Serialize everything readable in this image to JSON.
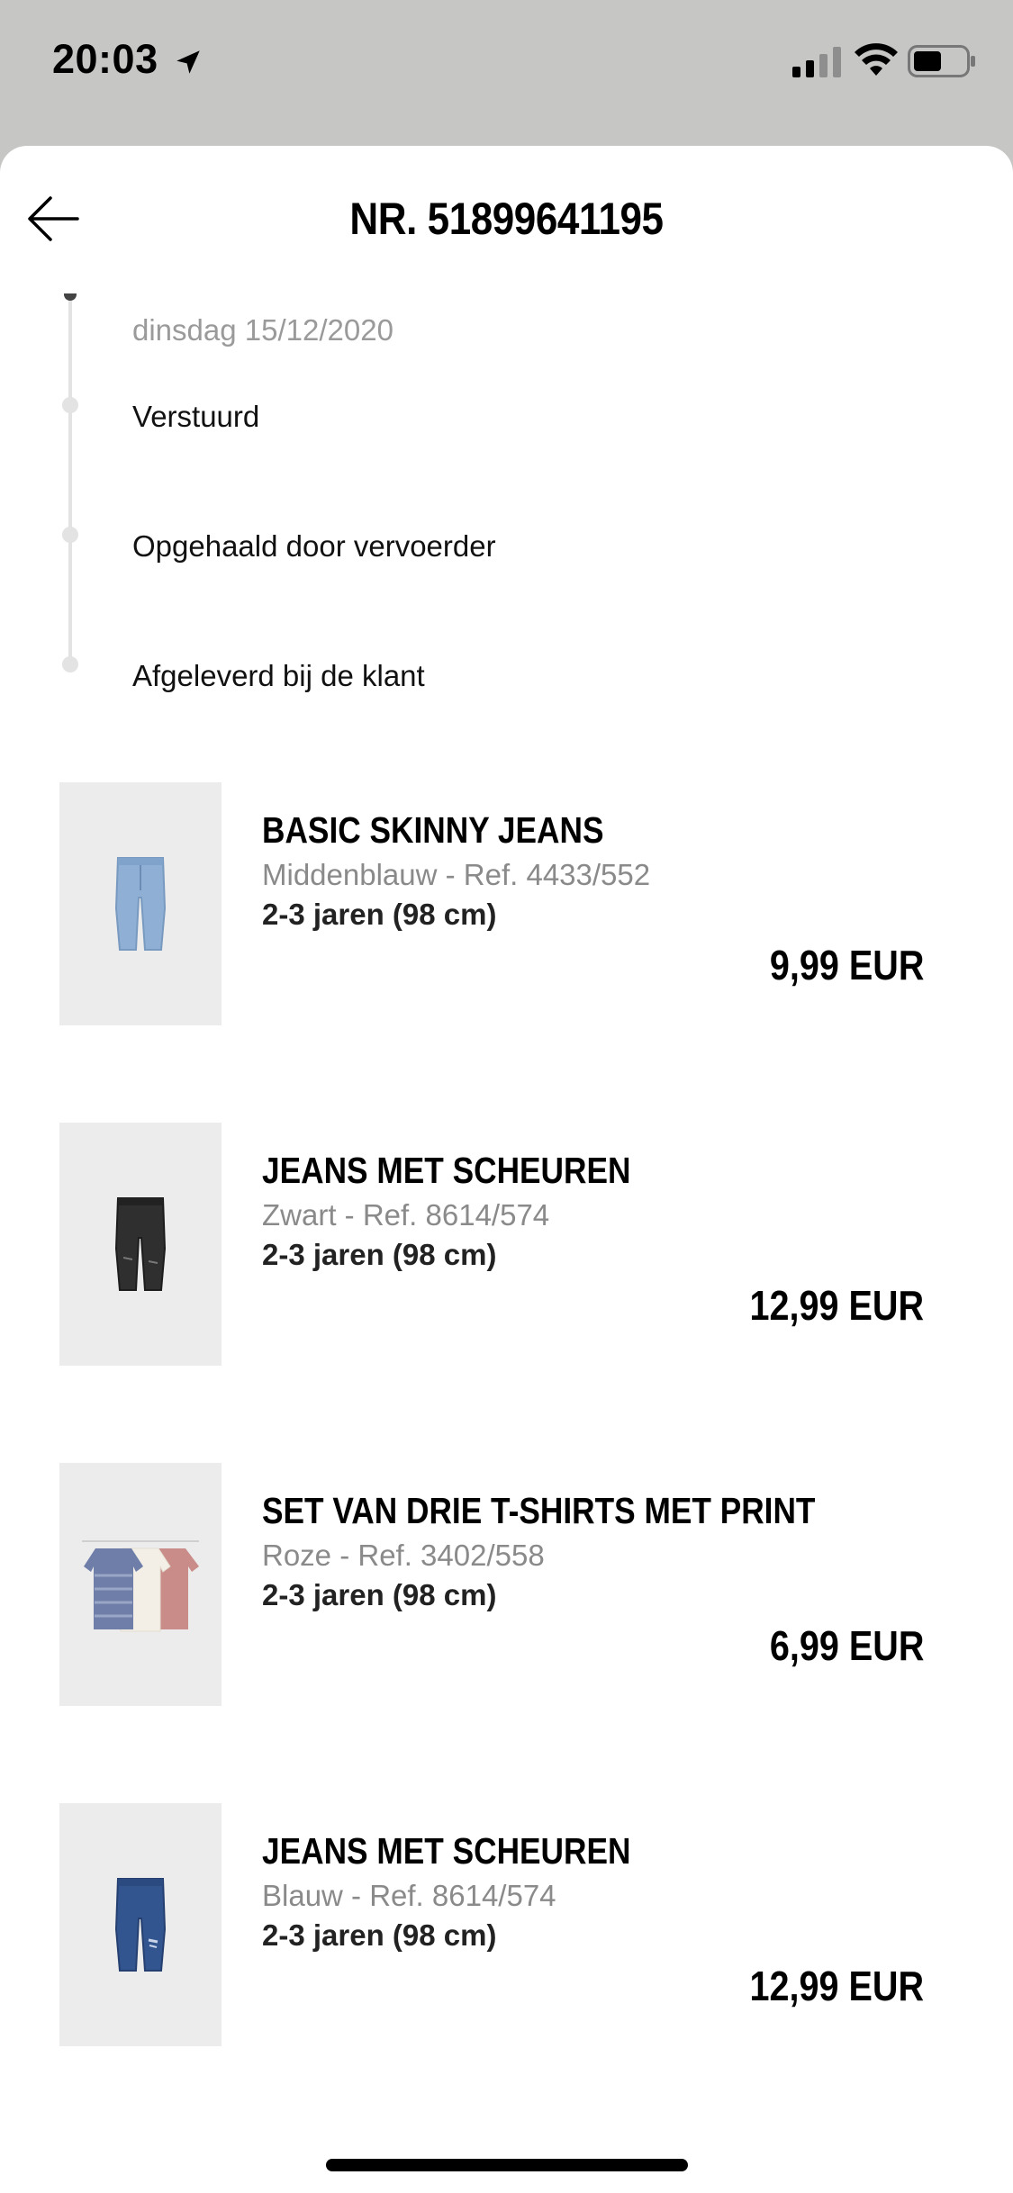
{
  "status_bar": {
    "time": "20:03",
    "icons": [
      "location-arrow-icon",
      "cellular-signal-icon",
      "wifi-icon",
      "battery-icon"
    ]
  },
  "header": {
    "title": "NR. 51899641195",
    "back_icon": "arrow-left-icon"
  },
  "timeline": {
    "date": "dinsdag 15/12/2020",
    "steps": [
      {
        "label": "Verstuurd"
      },
      {
        "label": "Opgehaald door vervoerder"
      },
      {
        "label": "Afgeleverd bij de klant"
      }
    ]
  },
  "products": [
    {
      "name": "BASIC SKINNY JEANS",
      "variant": "Middenblauw - Ref. 4433/552",
      "size": "2-3 jaren (98 cm)",
      "price": "9,99 EUR",
      "image": "light-blue-jeans"
    },
    {
      "name": "JEANS MET SCHEUREN",
      "variant": "Zwart - Ref. 8614/574",
      "size": "2-3 jaren (98 cm)",
      "price": "12,99 EUR",
      "image": "black-ripped-jeans"
    },
    {
      "name": "SET VAN DRIE T-SHIRTS MET PRINT",
      "variant": "Roze - Ref. 3402/558",
      "size": "2-3 jaren (98 cm)",
      "price": "6,99 EUR",
      "image": "three-tshirts-on-hangers"
    },
    {
      "name": "JEANS MET SCHEUREN",
      "variant": "Blauw - Ref. 8614/574",
      "size": "2-3 jaren (98 cm)",
      "price": "12,99 EUR",
      "image": "blue-ripped-jeans"
    }
  ],
  "colors": {
    "status_bg": "#c6c7c5",
    "sheet_bg": "#ffffff",
    "thumb_bg": "#ececec",
    "timeline": "#e3e3e3",
    "muted_text": "#8a8a8a"
  }
}
